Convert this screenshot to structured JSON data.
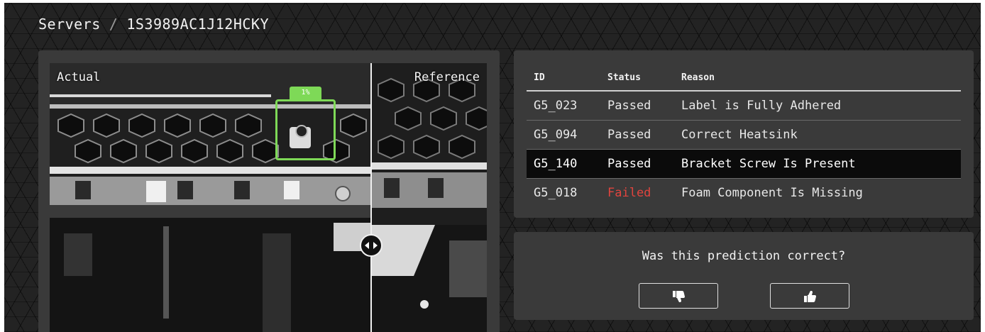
{
  "breadcrumb": {
    "root": "Servers",
    "separator": "/",
    "current": "1S3989AC1J12HCKY"
  },
  "viewer": {
    "actual_label": "Actual",
    "reference_label": "Reference",
    "detection_confidence": "1%"
  },
  "results_table": {
    "headers": {
      "id": "ID",
      "status": "Status",
      "reason": "Reason"
    },
    "rows": [
      {
        "id": "G5_023",
        "status": "Passed",
        "reason": "Label is Fully Adhered"
      },
      {
        "id": "G5_094",
        "status": "Passed",
        "reason": "Correct Heatsink"
      },
      {
        "id": "G5_140",
        "status": "Passed",
        "reason": "Bracket Screw Is Present"
      },
      {
        "id": "G5_018",
        "status": "Failed",
        "reason": "Foam Component Is Missing"
      }
    ],
    "selected_row": 2
  },
  "feedback": {
    "question": "Was this prediction correct?",
    "thumbs_down_icon": "thumbs-down-icon",
    "thumbs_up_icon": "thumbs-up-icon"
  },
  "colors": {
    "detection_green": "#7ed957",
    "failed_red": "#e0443e",
    "card_background": "#3a3a3a"
  }
}
